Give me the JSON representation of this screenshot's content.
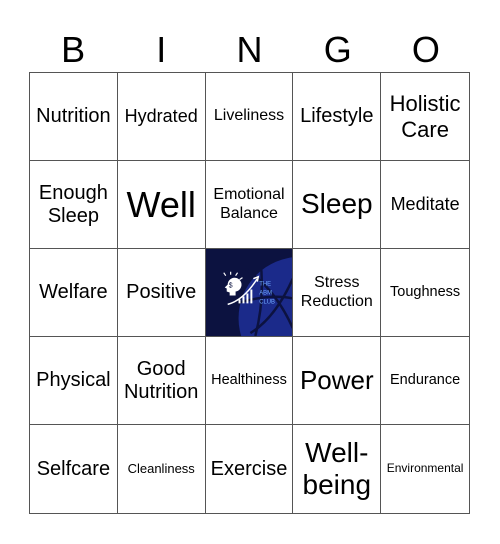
{
  "header": {
    "letters": [
      "B",
      "I",
      "N",
      "G",
      "O"
    ]
  },
  "free_space": {
    "icon": "abm-club-logo",
    "text_lines": [
      "THE",
      "ABM",
      "CLUB"
    ],
    "bg_color": "#0c1240",
    "accent_color": "#1b2a8a"
  },
  "cells": [
    "Nutrition",
    "Hydrated",
    "Liveliness",
    "Lifestyle",
    "Holistic Care",
    "Enough Sleep",
    "Well",
    "Emotional Balance",
    "Sleep",
    "Meditate",
    "Welfare",
    "Positive",
    "",
    "Stress Reduction",
    "Toughness",
    "Physical",
    "Good Nutrition",
    "Healthiness",
    "Power",
    "Endurance",
    "Selfcare",
    "Cleanliness",
    "Exercise",
    "Well-being",
    "Environmental"
  ]
}
